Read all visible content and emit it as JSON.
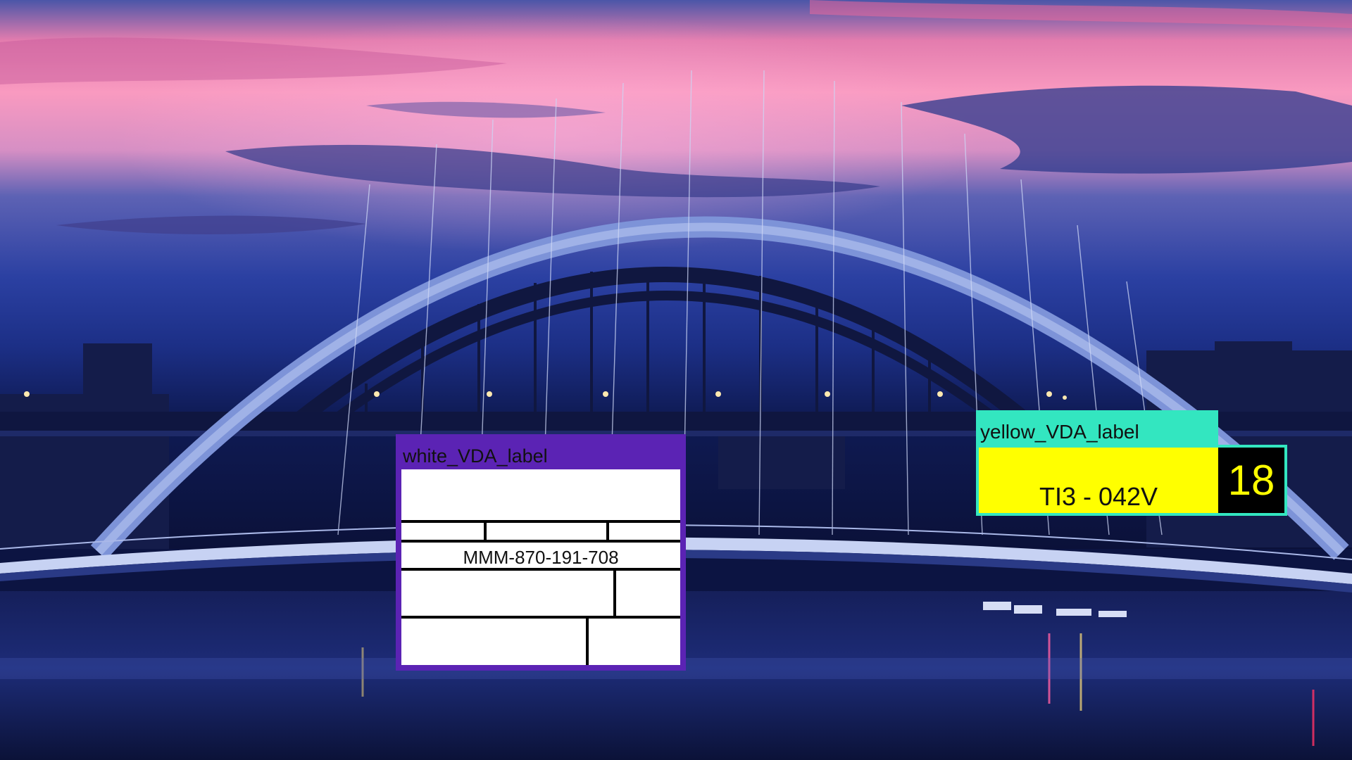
{
  "scene": {
    "icon": "bridge-dusk-photo",
    "colors": {
      "sky_top": "#5a5fb8",
      "sky_pink": "#f58ab6",
      "sky_blue": "#233c9c",
      "water": "#0b1238",
      "arch": "#9fb4ec",
      "bridge_dark": "#141c48"
    }
  },
  "white_label": {
    "title": "white_VDA_label",
    "code": "MMM-870-191-708",
    "color": "#5b23b4"
  },
  "yellow_label": {
    "title": "yellow_VDA_label",
    "text": "TI3 - 042V",
    "number": "18",
    "color": "#33e6c0",
    "fill": "#ffff00"
  }
}
